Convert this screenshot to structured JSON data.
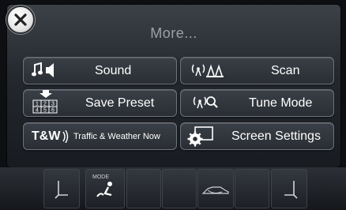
{
  "header": {
    "title": "More..."
  },
  "close": {
    "icon": "close-icon"
  },
  "menu": {
    "sound": {
      "label": "Sound",
      "icon": "sound-icon"
    },
    "scan": {
      "label": "Scan",
      "icon": "scan-icon"
    },
    "save_preset": {
      "label": "Save Preset",
      "icon": "save-preset-icon",
      "preset_numbers": [
        "1",
        "2",
        "3",
        "4",
        "5",
        "6"
      ]
    },
    "tune_mode": {
      "label": "Tune Mode",
      "icon": "tune-mode-icon"
    },
    "traffic": {
      "label": "Traffic & Weather Now",
      "icon_text": "T&W"
    },
    "screen_settings": {
      "label": "Screen Settings",
      "icon": "screen-settings-icon"
    }
  },
  "dock": {
    "mode_label": "MODE",
    "items": [
      "seat-left-icon",
      "mode-airflow-icon",
      "blank",
      "blank",
      "defrost-icon",
      "blank",
      "seat-right-icon"
    ]
  },
  "colors": {
    "accent": "#ffffff",
    "button_border": "#6d737c",
    "background": "#24282e"
  }
}
